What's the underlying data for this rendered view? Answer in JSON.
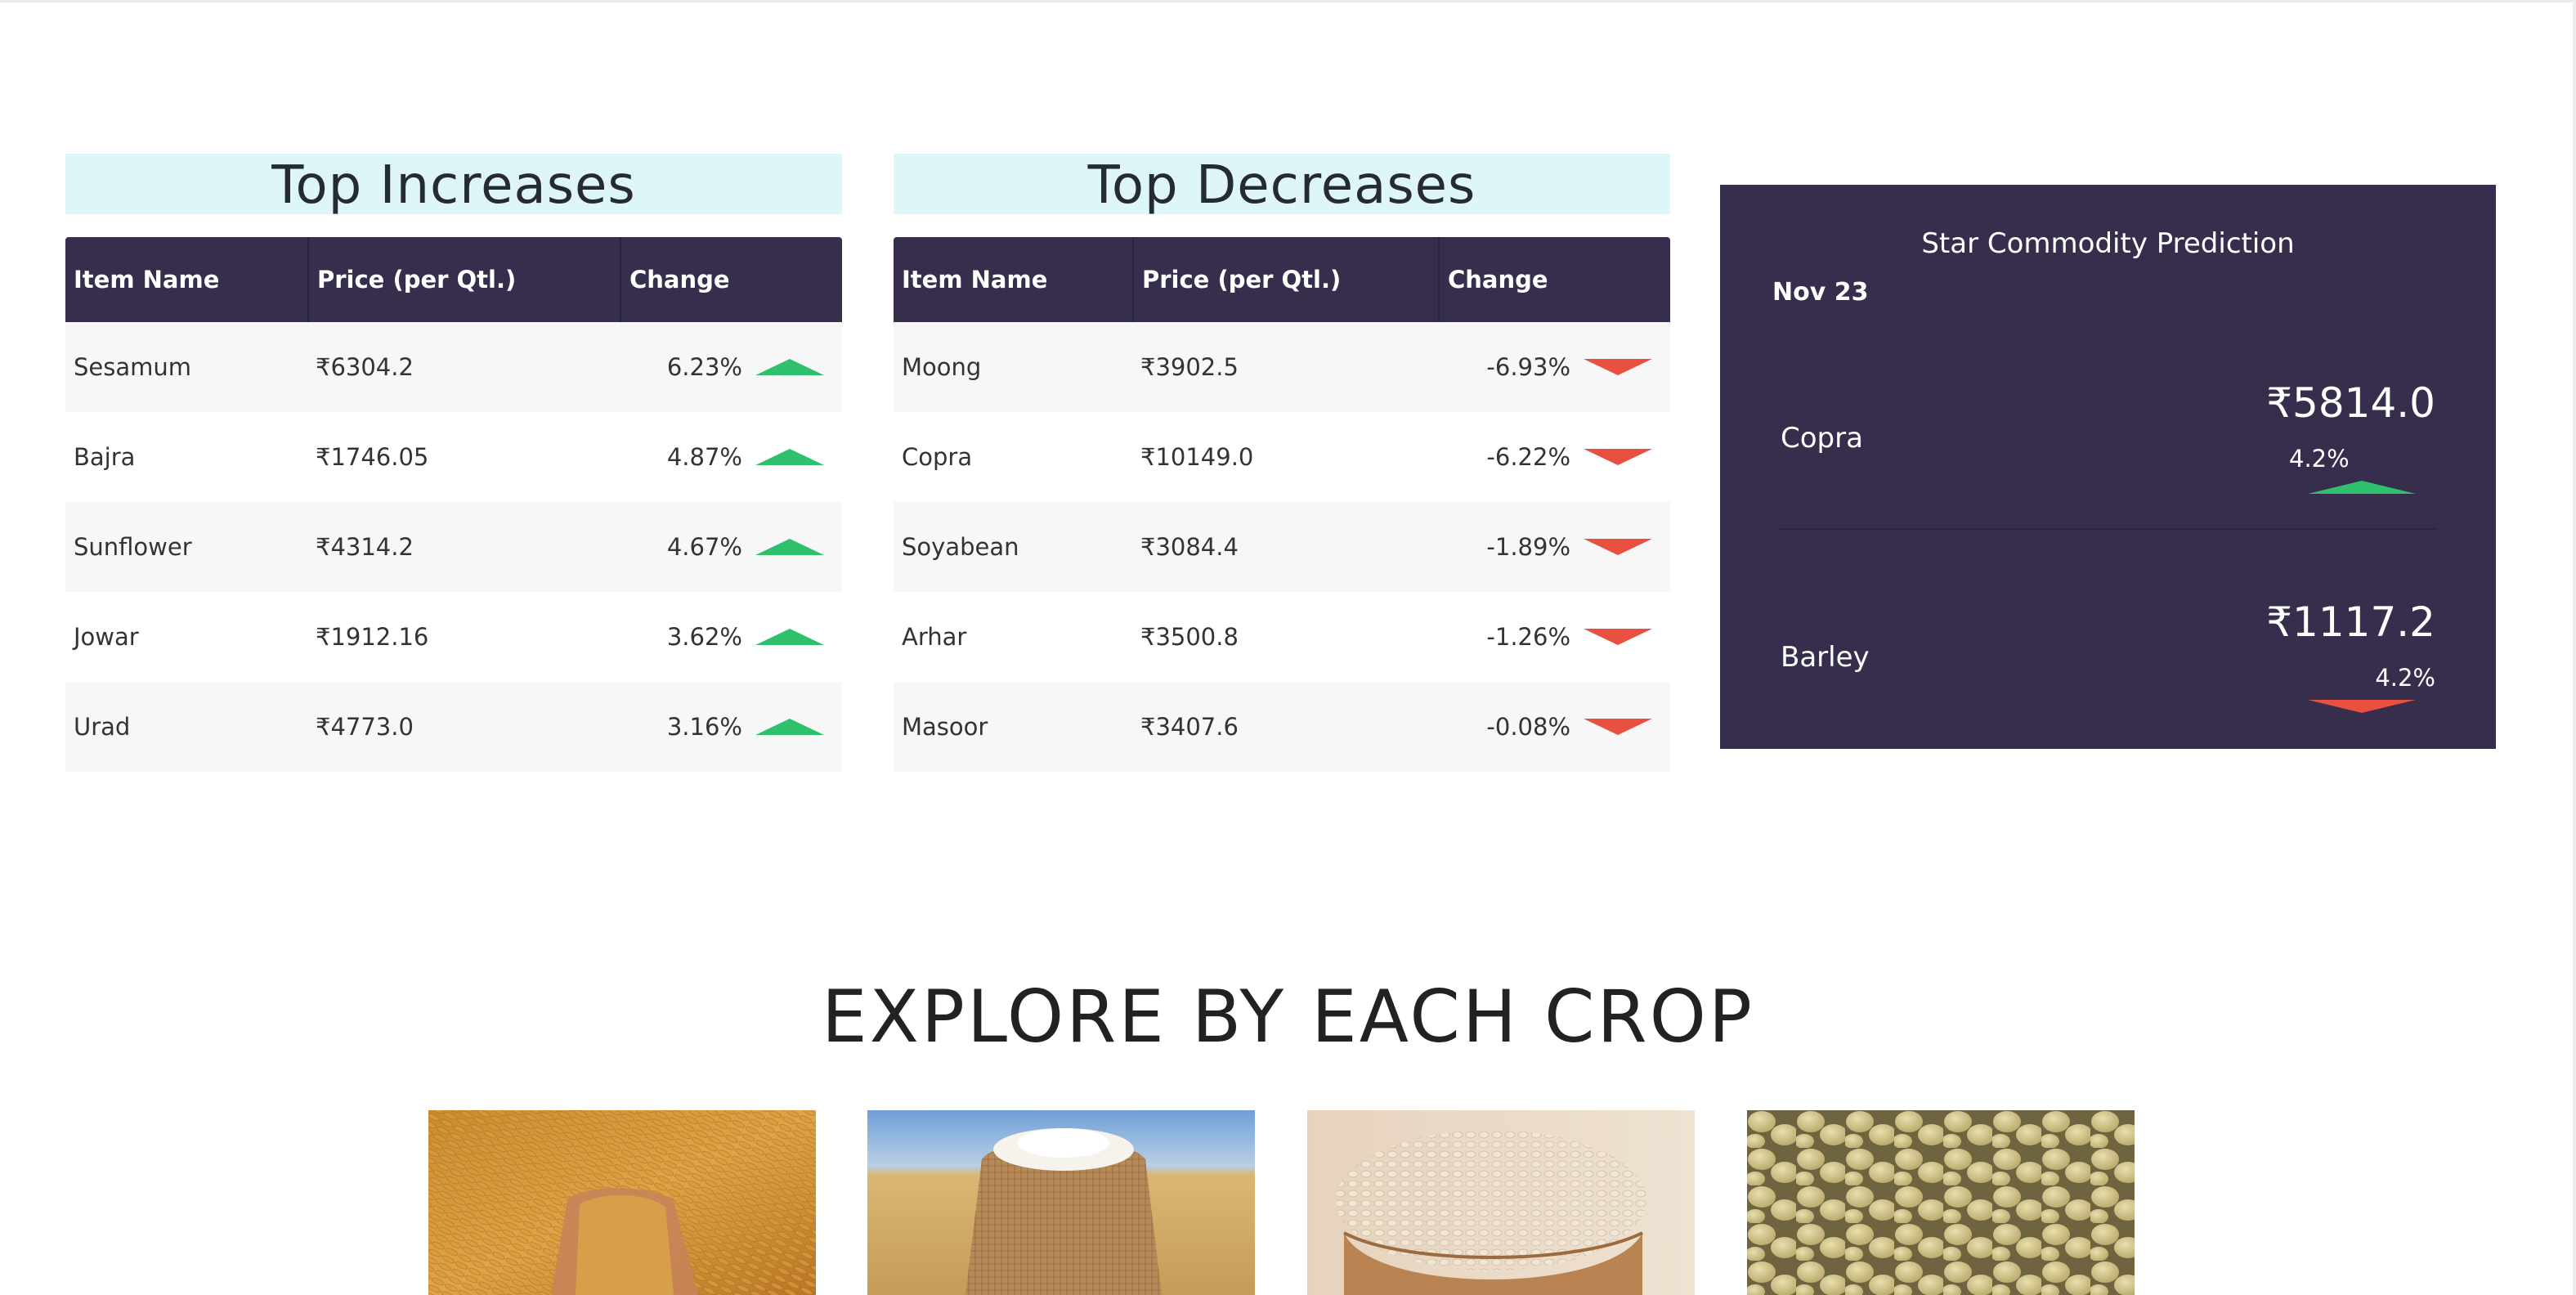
{
  "increases": {
    "title": "Top Increases",
    "headers": [
      "Item Name",
      "Price (per Qtl.)",
      "Change"
    ],
    "rows": [
      {
        "name": "Sesamum",
        "price": "₹6304.2",
        "change": "6.23%"
      },
      {
        "name": "Bajra",
        "price": "₹1746.05",
        "change": "4.87%"
      },
      {
        "name": "Sunflower",
        "price": "₹4314.2",
        "change": "4.67%"
      },
      {
        "name": "Jowar",
        "price": "₹1912.16",
        "change": "3.62%"
      },
      {
        "name": "Urad",
        "price": "₹4773.0",
        "change": "3.16%"
      }
    ]
  },
  "decreases": {
    "title": "Top Decreases",
    "headers": [
      "Item Name",
      "Price (per Qtl.)",
      "Change"
    ],
    "rows": [
      {
        "name": "Moong",
        "price": "₹3902.5",
        "change": "-6.93%"
      },
      {
        "name": "Copra",
        "price": "₹10149.0",
        "change": "-6.22%"
      },
      {
        "name": "Soyabean",
        "price": "₹3084.4",
        "change": "-1.89%"
      },
      {
        "name": "Arhar",
        "price": "₹3500.8",
        "change": "-1.26%"
      },
      {
        "name": "Masoor",
        "price": "₹3407.6",
        "change": "-0.08%"
      }
    ]
  },
  "star": {
    "title": "Star Commodity Prediction",
    "date": "Nov 23",
    "items": [
      {
        "name": "Copra",
        "price": "₹5814.0",
        "change": "4.2%",
        "trend": "up"
      },
      {
        "name": "Barley",
        "price": "₹1117.2",
        "change": "4.2%",
        "trend": "down"
      }
    ]
  },
  "explore": {
    "title": "EXPLORE BY EACH CROP",
    "cards": [
      {
        "image": "paddy-grains-in-hands"
      },
      {
        "image": "sack-of-flour-in-wheat-field"
      },
      {
        "image": "barley-grains-in-wooden-bowl"
      },
      {
        "image": "soybeans-closeup"
      }
    ]
  },
  "colors": {
    "header_bg": "#362e4c",
    "title_bg": "#def6f8",
    "up": "#2fc06e",
    "down": "#e8503f"
  }
}
